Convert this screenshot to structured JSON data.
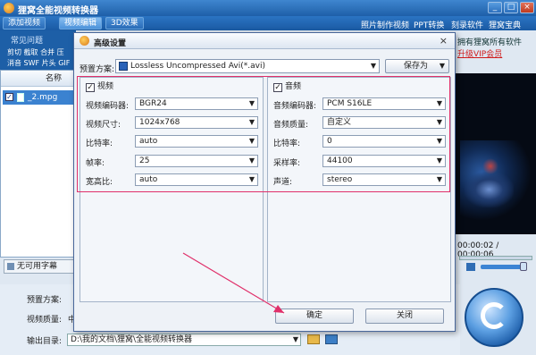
{
  "app": {
    "title": "狸窝全能视频转换器",
    "window_buttons": [
      "_",
      "□",
      "×"
    ]
  },
  "toolbar": {
    "tabs": [
      "添加视频",
      "视频编辑",
      "3D效果"
    ],
    "links": [
      "照片制作视频",
      "PPT转换",
      "刻录软件",
      "狸窝宝典"
    ]
  },
  "left_panel": {
    "faq": "常见问题",
    "tools_line1": "剪切 截取 合并 压",
    "tools_line2": "消音 SWF 片头 GIF",
    "list_header": "名称",
    "file_name": "_2.mpg",
    "subtitle": "无可用字幕"
  },
  "promo": {
    "line1": "拥有狸窝所有软件",
    "line2": "升级VIP会员"
  },
  "player": {
    "time": "00:00:02 / 00:00:06"
  },
  "bottom": {
    "preset_label": "预置方案:",
    "quality_label": "视频质量:",
    "quality_value": "中",
    "output_label": "输出目录:",
    "output_path": "D:\\我的文档\\狸窝\\全能视频转换器"
  },
  "dialog": {
    "title": "高级设置",
    "close_glyph": "×",
    "preset_label": "预置方案:",
    "preset_value": "Lossless Uncompressed Avi(*.avi)",
    "save_as": "保存为",
    "video": {
      "header": "视频",
      "checked": true,
      "fields": [
        {
          "label": "视频编码器:",
          "value": "BGR24"
        },
        {
          "label": "视频尺寸:",
          "value": "1024x768"
        },
        {
          "label": "比特率:",
          "value": "auto"
        },
        {
          "label": "帧率:",
          "value": "25"
        },
        {
          "label": "宽高比:",
          "value": "auto"
        }
      ]
    },
    "audio": {
      "header": "音频",
      "checked": true,
      "fields": [
        {
          "label": "音频编码器:",
          "value": "PCM S16LE"
        },
        {
          "label": "音频质量:",
          "value": "自定义"
        },
        {
          "label": "比特率:",
          "value": "0"
        },
        {
          "label": "采样率:",
          "value": "44100"
        },
        {
          "label": "声道:",
          "value": "stereo"
        }
      ]
    },
    "ok": "确定",
    "close": "关闭"
  },
  "annotation": {
    "color": "#e0306a"
  },
  "glyphs": {
    "dropdown": "▼",
    "check": "✓"
  }
}
